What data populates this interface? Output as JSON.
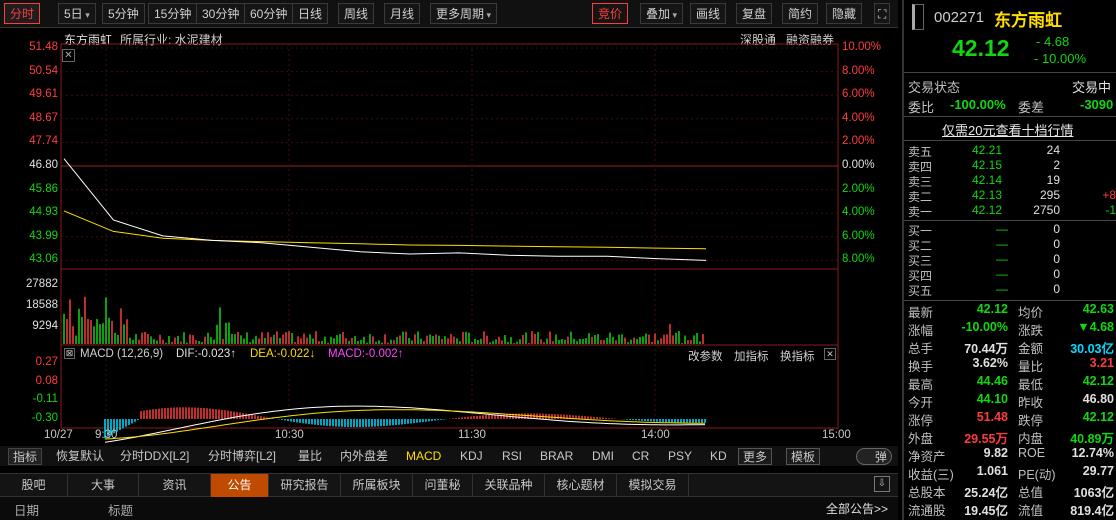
{
  "toolbar": {
    "left": [
      "分时",
      "5日",
      "5分钟",
      "15分钟",
      "30分钟",
      "60分钟",
      "日线",
      "周线",
      "月线",
      "更多周期"
    ],
    "right": [
      "竞价",
      "叠加",
      "画线",
      "复盘",
      "简约",
      "隐藏"
    ],
    "fullscreen_icon": "expand-icon"
  },
  "header": {
    "stock_name": "东方雨虹",
    "industry": "所属行业: 水泥建材",
    "sz_connect": "深股通",
    "margin": "融资融券"
  },
  "axes": {
    "price_left": [
      "51.48",
      "50.54",
      "49.61",
      "48.67",
      "47.74",
      "46.80",
      "45.86",
      "44.93",
      "43.99",
      "43.06"
    ],
    "pct_right": [
      "10.00%",
      "8.00%",
      "6.00%",
      "4.00%",
      "2.00%",
      "0.00%",
      "2.00%",
      "4.00%",
      "6.00%",
      "8.00%"
    ],
    "vol_left": [
      "27882",
      "18588",
      "9294"
    ],
    "macd_left": [
      "0.27",
      "0.08",
      "-0.11",
      "-0.30"
    ],
    "time": [
      "10/27",
      "9:30",
      "10:30",
      "11:30",
      "14:00",
      "15:00"
    ]
  },
  "macd": {
    "title": "MACD (12,26,9)",
    "dif": "DIF:-0.023↑",
    "dea": "DEA:-0.022↓",
    "macd": "MACD:-0.002↑",
    "btn1": "改参数",
    "btn2": "加指标",
    "btn3": "换指标"
  },
  "bottom_bar": {
    "items": [
      "指标",
      "恢复默认",
      "分时DDX[L2]",
      "分时博弈[L2]",
      "量比",
      "内外盘差",
      "MACD",
      "KDJ",
      "RSI",
      "BRAR",
      "DMI",
      "CR",
      "PSY",
      "KD",
      "更多",
      "模板",
      "弹"
    ]
  },
  "tabs": {
    "items": [
      "股吧",
      "大事",
      "资讯",
      "公告",
      "研究报告",
      "所属板块",
      "问董秘",
      "关联品种",
      "核心题材",
      "模拟交易"
    ],
    "list_header_date": "日期",
    "list_header_title": "标题",
    "all_announcements": "全部公告>>"
  },
  "quote": {
    "code": "002271",
    "name": "东方雨虹",
    "price": "42.12",
    "change": "- 4.68",
    "change_pct": "- 10.00%"
  },
  "status": {
    "label": "交易状态",
    "value": "交易中",
    "wb_label": "委比",
    "wb": "-100.00%",
    "wc_label": "委差",
    "wc": "-3090",
    "promo": "仅需20元查看十档行情"
  },
  "asks": [
    {
      "label": "卖五",
      "price": "42.21",
      "vol": "24",
      "chg": ""
    },
    {
      "label": "卖四",
      "price": "42.15",
      "vol": "2",
      "chg": ""
    },
    {
      "label": "卖三",
      "price": "42.14",
      "vol": "19",
      "chg": ""
    },
    {
      "label": "卖二",
      "price": "42.13",
      "vol": "295",
      "chg": "+8"
    },
    {
      "label": "卖一",
      "price": "42.12",
      "vol": "2750",
      "chg": "-1"
    }
  ],
  "bids": [
    {
      "label": "买一",
      "price": "—",
      "vol": "0"
    },
    {
      "label": "买二",
      "price": "—",
      "vol": "0"
    },
    {
      "label": "买三",
      "price": "—",
      "vol": "0"
    },
    {
      "label": "买四",
      "price": "—",
      "vol": "0"
    },
    {
      "label": "买五",
      "price": "—",
      "vol": "0"
    }
  ],
  "stats": [
    {
      "l1": "最新",
      "v1": "42.12",
      "c1": "gr",
      "l2": "均价",
      "v2": "42.63",
      "c2": "gr"
    },
    {
      "l1": "涨幅",
      "v1": "-10.00%",
      "c1": "gr",
      "l2": "涨跌",
      "v2": "▼4.68",
      "c2": "gr"
    },
    {
      "l1": "总手",
      "v1": "70.44万",
      "c1": "wh",
      "l2": "金额",
      "v2": "30.03亿",
      "c2": "cy"
    },
    {
      "l1": "换手",
      "v1": "3.62%",
      "c1": "wh",
      "l2": "量比",
      "v2": "3.21",
      "c2": "rd"
    },
    {
      "l1": "最高",
      "v1": "44.46",
      "c1": "gr",
      "l2": "最低",
      "v2": "42.12",
      "c2": "gr"
    },
    {
      "l1": "今开",
      "v1": "44.10",
      "c1": "gr",
      "l2": "昨收",
      "v2": "46.80",
      "c2": "wh"
    },
    {
      "l1": "涨停",
      "v1": "51.48",
      "c1": "rd",
      "l2": "跌停",
      "v2": "42.12",
      "c2": "gr"
    },
    {
      "l1": "外盘",
      "v1": "29.55万",
      "c1": "rd",
      "l2": "内盘",
      "v2": "40.89万",
      "c2": "gr"
    },
    {
      "l1": "净资产",
      "v1": "9.82",
      "c1": "wh",
      "l2": "ROE",
      "v2": "12.74%",
      "c2": "wh"
    },
    {
      "l1": "收益(三)",
      "v1": "1.061",
      "c1": "wh",
      "l2": "PE(动)",
      "v2": "29.77",
      "c2": "wh"
    },
    {
      "l1": "总股本",
      "v1": "25.24亿",
      "c1": "wh",
      "l2": "总值",
      "v2": "1063亿",
      "c2": "wh"
    },
    {
      "l1": "流通股",
      "v1": "19.45亿",
      "c1": "wh",
      "l2": "流值",
      "v2": "819.4亿",
      "c2": "wh"
    }
  ],
  "colors": {
    "up": "#ff3c3c",
    "down": "#11d711",
    "price_line": "#ffffff",
    "avg_line": "#ffde00",
    "accent": "#c04a00"
  },
  "chart_data": {
    "type": "line",
    "title": "",
    "prev_close": 46.8,
    "x": [
      "9:30",
      "9:45",
      "10:00",
      "10:15",
      "10:30",
      "10:45",
      "11:00",
      "11:15",
      "11:30",
      "13:15",
      "13:30",
      "13:45",
      "14:00",
      "14:15"
    ],
    "series": [
      {
        "values": [
          46.6,
          43.9,
          43.2,
          43.0,
          42.9,
          42.7,
          42.5,
          42.4,
          42.45,
          42.35,
          42.3,
          42.3,
          42.2,
          42.12
        ]
      },
      {
        "values": [
          44.3,
          43.4,
          43.1,
          43.0,
          42.95,
          42.9,
          42.85,
          42.8,
          42.78,
          42.75,
          42.72,
          42.7,
          42.66,
          42.63
        ]
      }
    ],
    "ylim": [
      42.12,
      51.48
    ]
  }
}
